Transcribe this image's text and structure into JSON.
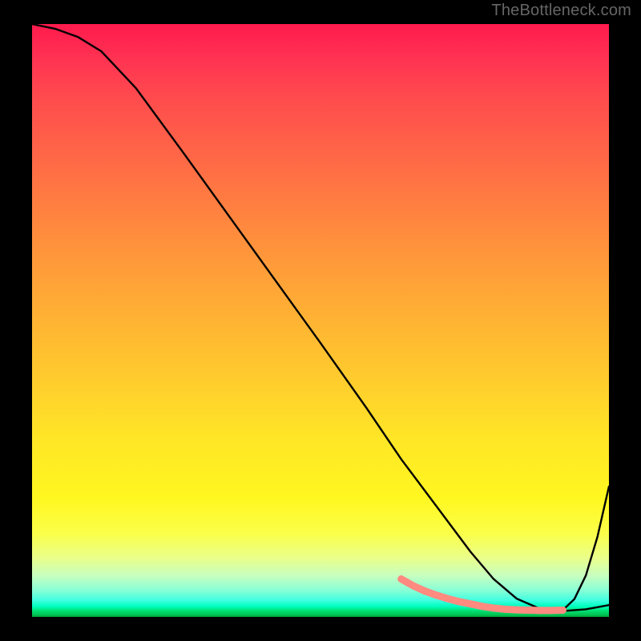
{
  "attribution": "TheBottleneck.com",
  "chart_data": {
    "type": "line",
    "title": "",
    "xlabel": "",
    "ylabel": "",
    "xlim": [
      0,
      100
    ],
    "ylim": [
      0,
      100
    ],
    "background_gradient": {
      "orientation": "vertical",
      "stops": [
        {
          "pos": 0.0,
          "color": "#ff1a4d"
        },
        {
          "pos": 0.5,
          "color": "#ffb333"
        },
        {
          "pos": 0.8,
          "color": "#fff720"
        },
        {
          "pos": 0.93,
          "color": "#c8ffbf"
        },
        {
          "pos": 0.98,
          "color": "#00ffc0"
        },
        {
          "pos": 1.0,
          "color": "#009933"
        }
      ]
    },
    "series": [
      {
        "name": "bottleneck-curve",
        "x": [
          0,
          4,
          8,
          12,
          18,
          26,
          34,
          42,
          50,
          58,
          64,
          68,
          72,
          76,
          80,
          84,
          88,
          92,
          96,
          100
        ],
        "y": [
          100,
          99.2,
          97.8,
          95.4,
          89.2,
          78.6,
          67.8,
          57.0,
          46.2,
          35.2,
          26.6,
          21.4,
          16.2,
          11.0,
          6.4,
          3.1,
          1.4,
          1.0,
          1.3,
          2.0,
          null
        ],
        "style": {
          "stroke": "#000000",
          "width": 2.4
        }
      },
      {
        "name": "optimal-band",
        "note": "bold salmon highlight over the flat minimum region",
        "x": [
          64,
          66,
          68,
          70,
          72,
          74,
          76,
          78,
          80,
          82,
          84,
          86,
          88,
          90,
          92
        ],
        "y": [
          6.4,
          5.3,
          4.4,
          3.7,
          3.1,
          2.6,
          2.2,
          1.8,
          1.5,
          1.3,
          1.2,
          1.15,
          1.1,
          1.1,
          1.15
        ],
        "style": {
          "stroke": "#ff8a80",
          "width": 9,
          "markers": true,
          "marker_r": 4.5
        }
      }
    ],
    "right_tail": {
      "x": [
        92,
        94,
        96,
        98,
        100
      ],
      "y": [
        1.15,
        3.0,
        7.0,
        13.5,
        22.0
      ]
    }
  }
}
